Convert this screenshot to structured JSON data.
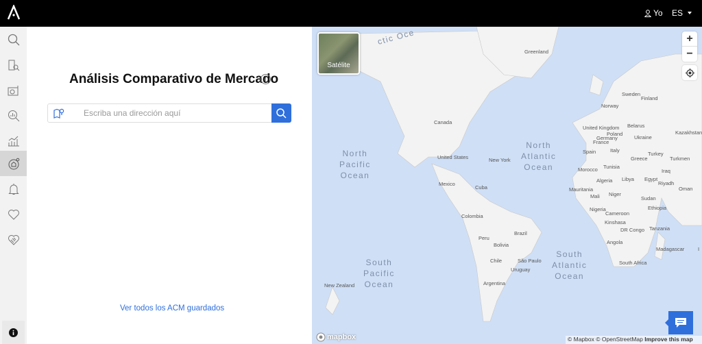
{
  "header": {
    "logo": "A",
    "user_label": "Yo",
    "language": "ES"
  },
  "sidebar": {
    "items": [
      {
        "name": "search",
        "icon": "search-icon"
      },
      {
        "name": "property-search",
        "icon": "building-search-icon"
      },
      {
        "name": "valuation",
        "icon": "globe-document-icon"
      },
      {
        "name": "market-analysis",
        "icon": "chart-search-icon"
      },
      {
        "name": "statistics",
        "icon": "bar-chart-icon"
      },
      {
        "name": "acm",
        "icon": "home-target-icon",
        "active": true
      },
      {
        "name": "alerts",
        "icon": "bell-icon"
      },
      {
        "name": "favorites",
        "icon": "heart-icon"
      },
      {
        "name": "deals",
        "icon": "handshake-icon"
      }
    ],
    "info_icon": "info-icon"
  },
  "panel": {
    "title": "Análisis Comparativo de Mercado",
    "search_placeholder": "Escriba una dirección aquí",
    "search_value": "",
    "saved_link": "Ver todos los ACM guardados"
  },
  "map": {
    "satellite_label": "Satélite",
    "zoom_in": "+",
    "zoom_out": "−",
    "oceans": [
      "ctic Oce",
      "North\nPacific\nOcean",
      "North\nAtlantic\nOcean",
      "South\nPacific\nOcean",
      "South\nAtlantic\nOcean"
    ],
    "labels": [
      "Greenland",
      "Sweden",
      "Norway",
      "Finland",
      "United Kingdom",
      "Belarus",
      "Poland",
      "Ukraine",
      "Germany",
      "France",
      "Italy",
      "Spain",
      "Greece",
      "Turkey",
      "Turkmen",
      "Canada",
      "United States",
      "New York",
      "Mexico",
      "Cuba",
      "Morocco",
      "Tunisia",
      "Libya",
      "Egypt",
      "Algeria",
      "Iraq",
      "Riyadh",
      "Oman",
      "Mauritania",
      "Mali",
      "Niger",
      "Sudan",
      "Ethiopia",
      "Nigeria",
      "Cameroon",
      "Kinshasa",
      "DR Congo",
      "Tanzania",
      "Angola",
      "Madagascar",
      "South Africa",
      "Colombia",
      "Peru",
      "Brazil",
      "Bolivia",
      "Chile",
      "São Paulo",
      "Uruguay",
      "Argentina",
      "New Zealand",
      "Kazakhstan",
      "I"
    ],
    "logo": "mapbox",
    "attribution": {
      "mapbox": "© Mapbox",
      "osm": "© OpenStreetMap",
      "improve": "Improve this map"
    },
    "colors": {
      "ocean": "#cfdff6",
      "land": "#f3f3f3",
      "accent": "#2f6fdc"
    }
  }
}
